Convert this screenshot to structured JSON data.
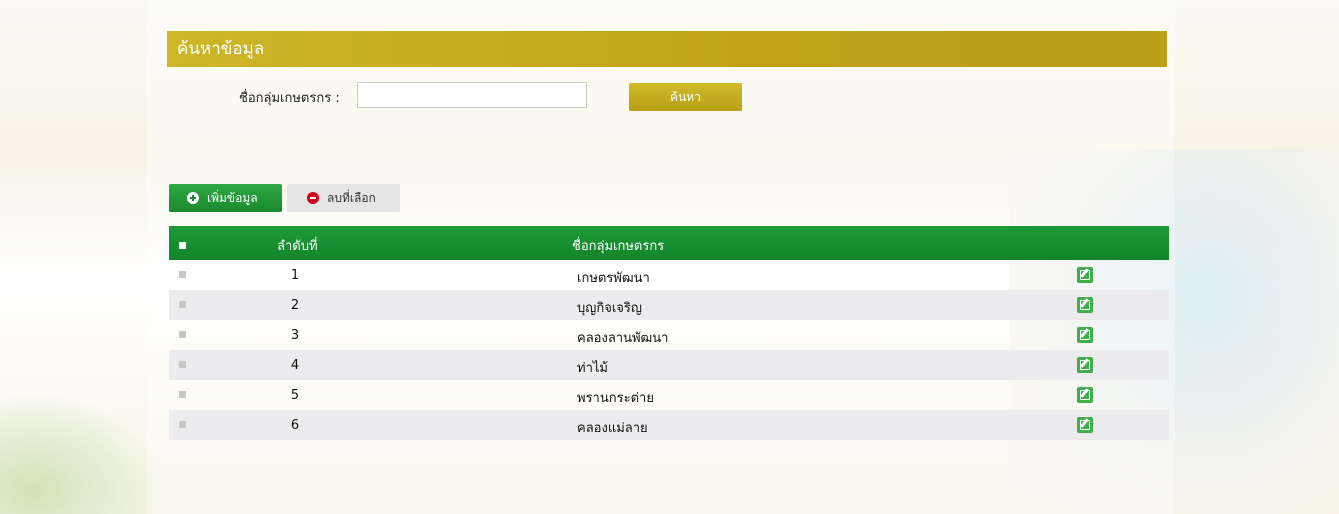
{
  "search": {
    "title": "ค้นหาข้อมูล",
    "label": "ชื่อกลุ่มเกษตรกร :",
    "input_value": "",
    "button_label": "ค้นหา"
  },
  "actions": {
    "add_label": "เพิ่มข้อมูล",
    "delete_label": "ลบที่เลือก"
  },
  "table": {
    "headers": {
      "seq": "ลำดับที่",
      "name": "ชื่อกลุ่มเกษตรกร"
    },
    "rows": [
      {
        "seq": "1",
        "name": "เกษตรพัฒนา"
      },
      {
        "seq": "2",
        "name": "บุญกิจเจริญ"
      },
      {
        "seq": "3",
        "name": "คลองลานพัฒนา"
      },
      {
        "seq": "4",
        "name": "ท่าไม้"
      },
      {
        "seq": "5",
        "name": "พรานกระต่าย"
      },
      {
        "seq": "6",
        "name": "คลองแม่ลาย"
      }
    ]
  },
  "colors": {
    "search_header": "#c2a71c",
    "table_header": "#17902f",
    "edit_icon": "#3fae4b"
  }
}
